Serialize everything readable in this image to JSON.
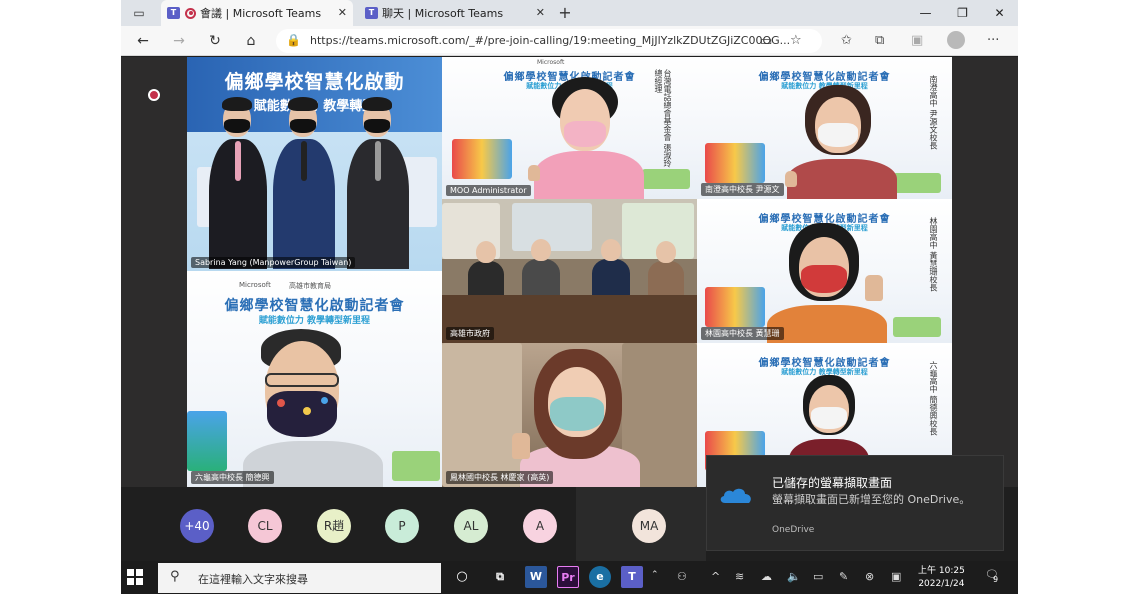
{
  "browser": {
    "tabs": [
      {
        "label": "會議 | Microsoft Teams",
        "active": true
      },
      {
        "label": "聊天 | Microsoft Teams",
        "active": false
      }
    ],
    "url": "https://teams.microsoft.com/_#/pre-join-calling/19:meeting_MjJlYzlkZDUtZGJiZC00OG..."
  },
  "poster": {
    "title": "偏鄉學校智慧化啟動記者會",
    "subtitle": "賦能數位力 教學轉型新里程",
    "brand_ms": "Microsoft",
    "brand_edu": "高雄市教育局",
    "banner_title": "偏鄉學校智慧化啟動",
    "banner_subtitle": "賦能數位力 教學轉型"
  },
  "participants": {
    "sabrina": "Sabrina Yang (ManpowerGroup Taiwan)",
    "moo": "MOO Administrator",
    "moo_side": "台灣電話總會基金會 張淑玲 總經理",
    "tile3": "南澄高中校長 尹源文",
    "tile3_side": "南澄高中 尹源文校長",
    "kaohsiung": "高雄市政府",
    "tile5": "林園高中校長 黃慧珊",
    "tile5_side": "林園高中 黃慧珊校長",
    "tile6": "六龜高中校長 簡德興",
    "tile7": "鳳林國中校長 林慶家 (高英)",
    "tile8_side": "六龜高中 簡德興校長"
  },
  "avatars": [
    {
      "initials": "+40",
      "color": "#5b5fc7",
      "text_color": "#ffffff"
    },
    {
      "initials": "CL",
      "color": "#f5c7d6",
      "text_color": "#333333"
    },
    {
      "initials": "R趙",
      "color": "#e8f0c8",
      "text_color": "#333333"
    },
    {
      "initials": "P",
      "color": "#c9ecd9",
      "text_color": "#333333"
    },
    {
      "initials": "AL",
      "color": "#d6ecd2",
      "text_color": "#333333"
    },
    {
      "initials": "A",
      "color": "#f8d3e0",
      "text_color": "#333333"
    },
    {
      "initials": "MA",
      "color": "#f2e4db",
      "text_color": "#333333"
    }
  ],
  "toast": {
    "title": "已儲存的螢幕擷取畫面",
    "body": "螢幕擷取畫面已新增至您的 OneDrive。",
    "app": "OneDrive"
  },
  "taskbar": {
    "search_placeholder": "在這裡輸入文字來搜尋",
    "time": "上午 10:25",
    "date": "2022/1/24",
    "notification_count": "9"
  },
  "colors": {
    "accent": "#5b5fc7",
    "recording": "#c4314b",
    "poster_blue": "#2b6fb6"
  }
}
